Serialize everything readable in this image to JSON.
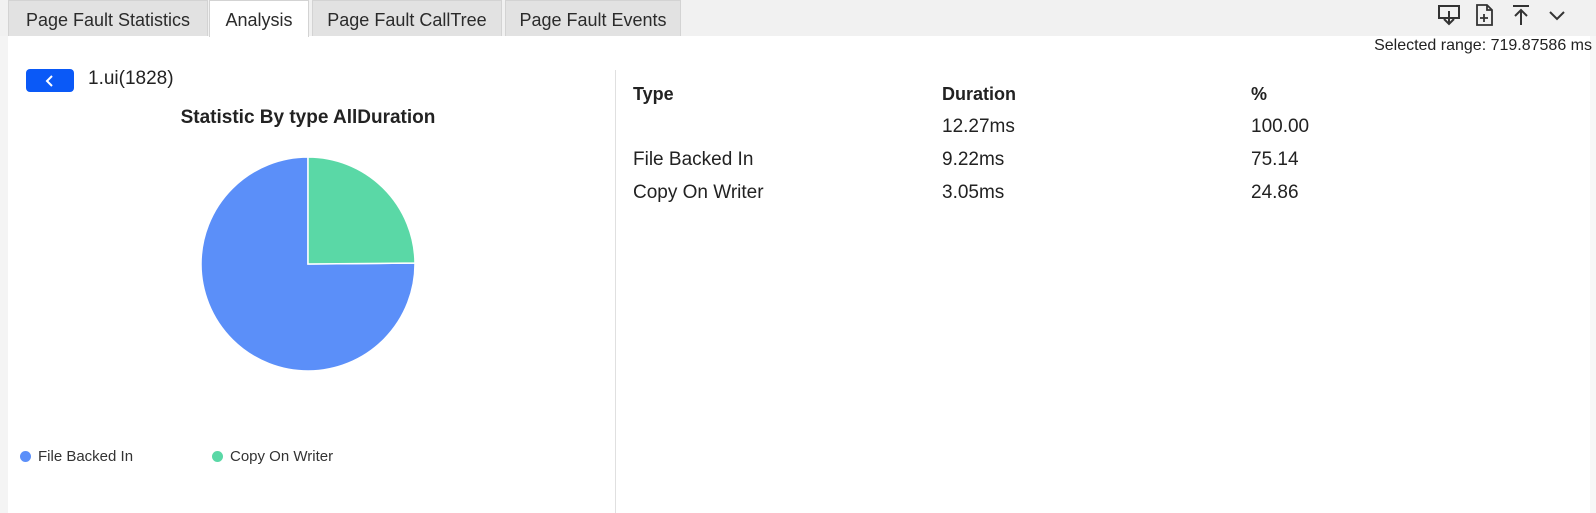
{
  "tabs": [
    {
      "label": "Page Fault Statistics",
      "active": false
    },
    {
      "label": "Analysis",
      "active": true
    },
    {
      "label": "Page Fault CallTree",
      "active": false
    },
    {
      "label": "Page Fault Events",
      "active": false
    }
  ],
  "toolbar": {
    "icons": [
      "download-icon",
      "export-file-icon",
      "move-to-top-icon",
      "chevron-down-icon"
    ]
  },
  "selected_range": "Selected range: 719.87586 ms",
  "process": {
    "name": "1.ui(1828)"
  },
  "chart_data": {
    "type": "pie",
    "title": "Statistic By type AllDuration",
    "categories": [
      "File Backed In",
      "Copy On Writer"
    ],
    "values": [
      75.14,
      24.86
    ],
    "colors": [
      "#5b8ff9",
      "#5ad8a6"
    ],
    "legend": "bottom-left"
  },
  "table": {
    "headers": {
      "type": "Type",
      "duration": "Duration",
      "percent": "%"
    },
    "total": {
      "type": "",
      "duration": "12.27ms",
      "percent": "100.00"
    },
    "rows": [
      {
        "type": "File Backed In",
        "duration": "9.22ms",
        "percent": "75.14"
      },
      {
        "type": "Copy On Writer",
        "duration": "3.05ms",
        "percent": "24.86"
      }
    ]
  }
}
